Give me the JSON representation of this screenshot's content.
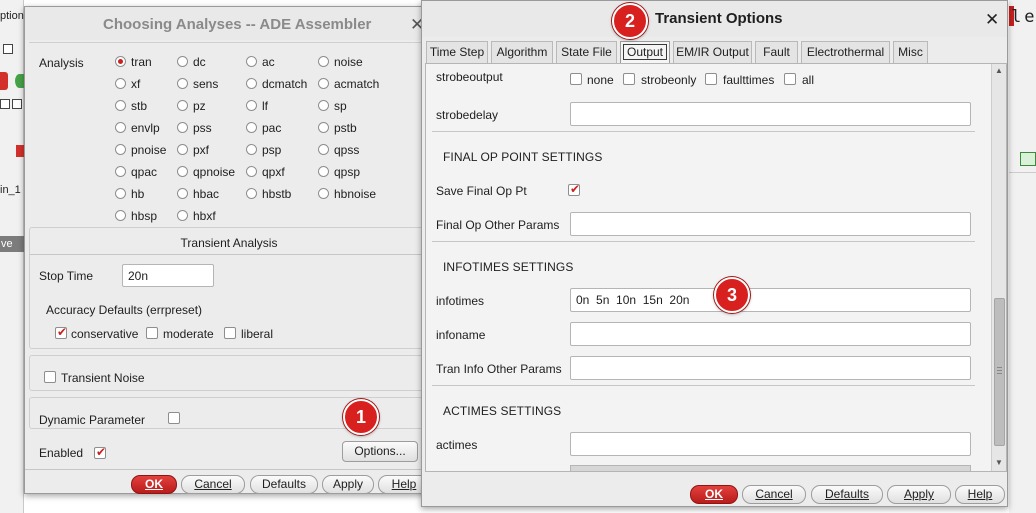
{
  "background": {
    "left_texts": [
      "ptions",
      "in_1"
    ],
    "left_selected": "ve",
    "right_logo": "len"
  },
  "choosing": {
    "title": "Choosing Analyses -- ADE Assembler",
    "analysis_label": "Analysis",
    "analyses": [
      [
        "tran",
        "dc",
        "ac",
        "noise"
      ],
      [
        "xf",
        "sens",
        "dcmatch",
        "acmatch"
      ],
      [
        "stb",
        "pz",
        "lf",
        "sp"
      ],
      [
        "envlp",
        "pss",
        "pac",
        "pstb"
      ],
      [
        "pnoise",
        "pxf",
        "psp",
        "qpss"
      ],
      [
        "qpac",
        "qpnoise",
        "qpxf",
        "qpsp"
      ],
      [
        "hb",
        "hbac",
        "hbstb",
        "hbnoise"
      ],
      [
        "hbsp",
        "hbxf"
      ]
    ],
    "selected_analysis": "tran",
    "transient_header": "Transient Analysis",
    "stop_time_label": "Stop Time",
    "stop_time_value": "20n",
    "accuracy_label": "Accuracy Defaults (errpreset)",
    "accuracy_options": [
      "conservative",
      "moderate",
      "liberal"
    ],
    "accuracy_checked": "conservative",
    "transient_noise_label": "Transient Noise",
    "dynamic_parameter_label": "Dynamic Parameter",
    "options_button": "Options...",
    "enabled_label": "Enabled",
    "buttons": {
      "ok": "OK",
      "cancel": "Cancel",
      "defaults": "Defaults",
      "apply": "Apply",
      "help": "Help"
    }
  },
  "transient_options": {
    "title": "Transient Options",
    "tabs": [
      "Time Step",
      "Algorithm",
      "State File",
      "Output",
      "EM/IR Output",
      "Fault",
      "Electrothermal",
      "Misc"
    ],
    "active_tab": "Output",
    "strobeoutput_label": "strobeoutput",
    "strobe_choices": [
      "none",
      "strobeonly",
      "faulttimes",
      "all"
    ],
    "strobedelay_label": "strobedelay",
    "strobedelay_value": "",
    "final_op_header": "FINAL OP POINT SETTINGS",
    "save_final_op_label": "Save Final Op Pt",
    "save_final_op_checked": true,
    "final_op_other_label": "Final Op Other Params",
    "final_op_other_value": "",
    "infotimes_header": "INFOTIMES SETTINGS",
    "infotimes_label": "infotimes",
    "infotimes_value": "0n  5n  10n  15n  20n",
    "infoname_label": "infoname",
    "infoname_value": "",
    "tran_info_other_label": "Tran Info Other Params",
    "tran_info_other_value": "",
    "actimes_header": "ACTIMES SETTINGS",
    "actimes_label": "actimes",
    "actimes_value": "",
    "buttons": {
      "ok": "OK",
      "cancel": "Cancel",
      "defaults": "Defaults",
      "apply": "Apply",
      "help": "Help"
    }
  },
  "annotations": {
    "badge1": "1",
    "badge2": "2",
    "badge3": "3"
  },
  "colors": {
    "accent_red": "#c8211e",
    "ok_button": "#d3302c",
    "badge": "#d8201f"
  }
}
